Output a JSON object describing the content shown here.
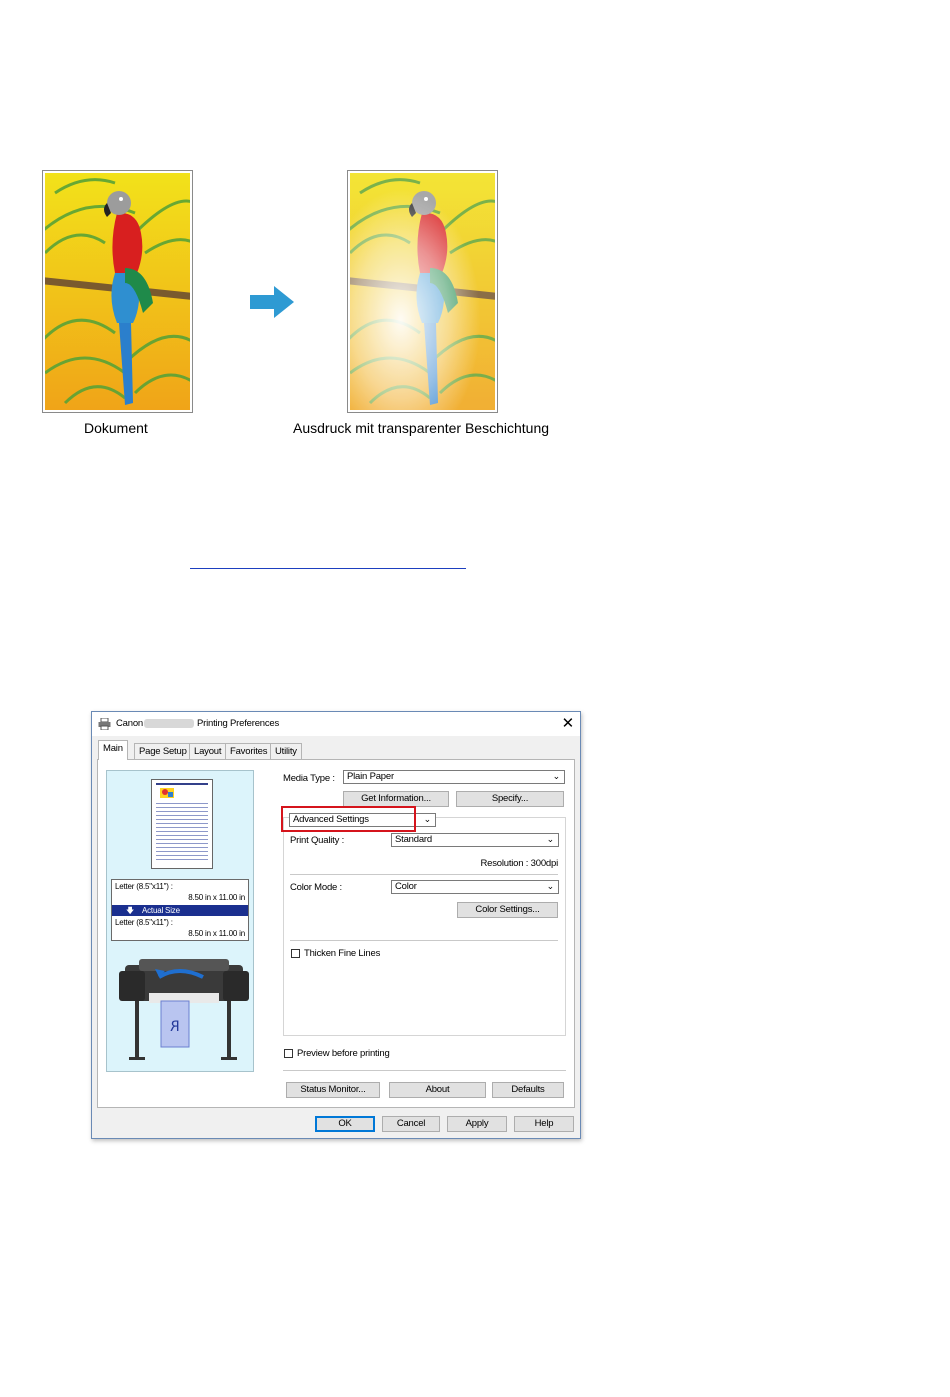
{
  "illustration": {
    "original_caption": "Dokument",
    "result_caption": "Ausdruck mit transparenter Beschichtung",
    "arrow_color": "#2e9ad3"
  },
  "dialog": {
    "title_prefix": "Canon",
    "title_suffix": "Printing Preferences",
    "close_label": "✕",
    "tabs": [
      "Main",
      "Page Setup",
      "Layout",
      "Favorites",
      "Utility"
    ],
    "preview": {
      "paper_size_1": "Letter (8.5\"x11\") :",
      "paper_dims_1": "8.50 in x 11.00 in",
      "scaling": "Actual Size",
      "paper_size_2": "Letter (8.5\"x11\") :",
      "paper_dims_2": "8.50 in x 11.00 in",
      "page_image_glyph": "R"
    },
    "media_type_label": "Media Type :",
    "media_type_value": "Plain Paper",
    "get_information_button": "Get Information...",
    "specify_button": "Specify...",
    "settings_mode_value": "Advanced Settings",
    "print_quality_label": "Print Quality :",
    "print_quality_value": "Standard",
    "resolution_text": "Resolution : 300dpi",
    "color_mode_label": "Color Mode :",
    "color_mode_value": "Color",
    "color_settings_button": "Color Settings...",
    "thicken_fine_lines_label": "Thicken Fine Lines",
    "preview_before_printing_label": "Preview before printing",
    "status_monitor_button": "Status Monitor...",
    "about_button": "About",
    "defaults_button": "Defaults",
    "ok_button": "OK",
    "cancel_button": "Cancel",
    "apply_button": "Apply",
    "help_button": "Help",
    "highlight_color": "#d5141c",
    "selection_color": "#1a2f8f"
  }
}
